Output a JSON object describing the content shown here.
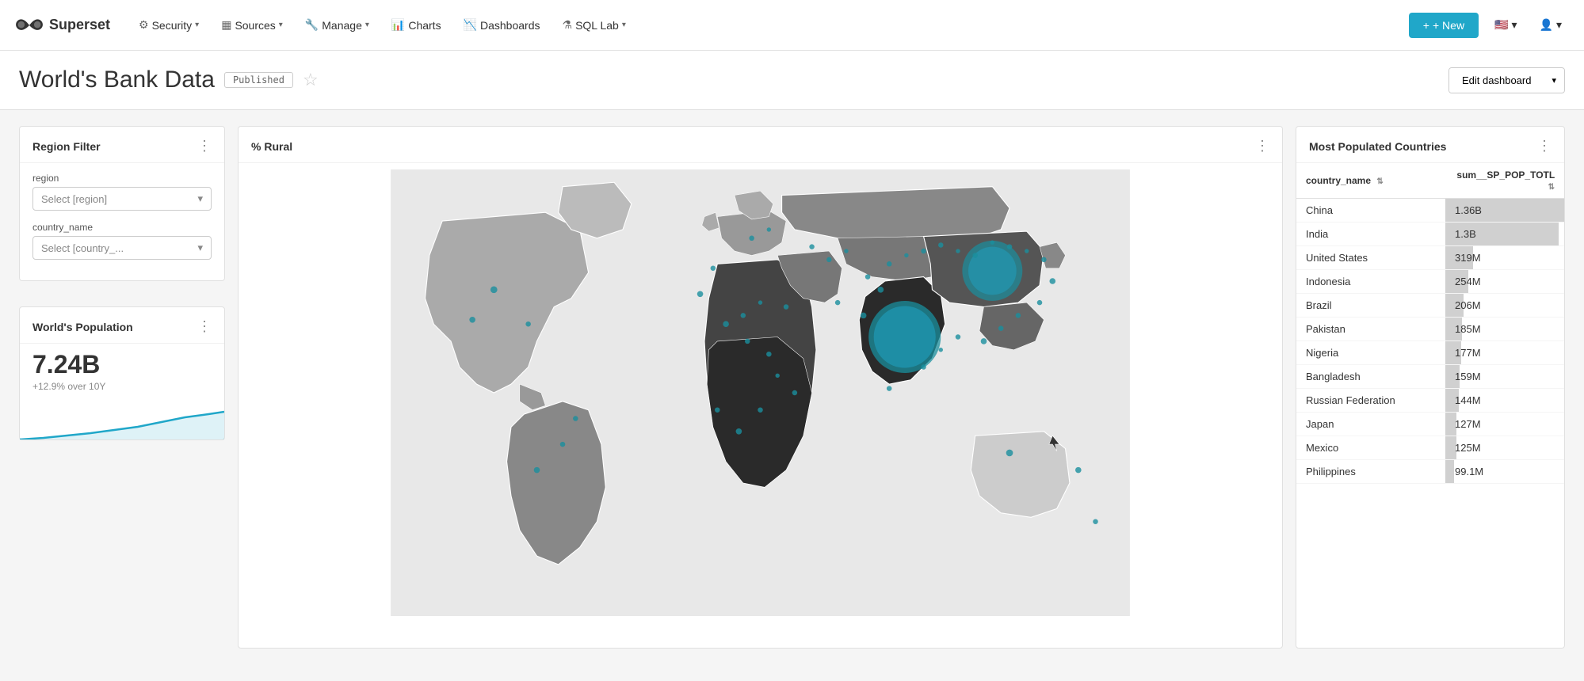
{
  "brand": {
    "name": "Superset"
  },
  "navbar": {
    "items": [
      {
        "id": "security",
        "label": "Security",
        "icon": "⚙",
        "hasDropdown": true
      },
      {
        "id": "sources",
        "label": "Sources",
        "icon": "▦",
        "hasDropdown": true
      },
      {
        "id": "manage",
        "label": "Manage",
        "icon": "🔧",
        "hasDropdown": true
      },
      {
        "id": "charts",
        "label": "Charts",
        "icon": "📊",
        "hasDropdown": false
      },
      {
        "id": "dashboards",
        "label": "Dashboards",
        "icon": "📉",
        "hasDropdown": false
      },
      {
        "id": "sqllab",
        "label": "SQL Lab",
        "icon": "⚗",
        "hasDropdown": true
      }
    ],
    "new_button": "+ New"
  },
  "dashboard": {
    "title": "World's Bank Data",
    "status_badge": "Published",
    "edit_button": "Edit dashboard",
    "star_label": "★"
  },
  "region_filter": {
    "title": "Region Filter",
    "region_label": "region",
    "region_placeholder": "Select [region]",
    "country_label": "country_name",
    "country_placeholder": "Select [country_..."
  },
  "population": {
    "title": "World's Population",
    "value": "7.24B",
    "change": "+12.9% over 10Y"
  },
  "map": {
    "title": "% Rural"
  },
  "table": {
    "title": "Most Populated Countries",
    "col1": "country_name",
    "col2": "sum__SP_POP_TOTL",
    "rows": [
      {
        "country": "China",
        "value": "1.36B",
        "pct": 100
      },
      {
        "country": "India",
        "value": "1.3B",
        "pct": 95
      },
      {
        "country": "United States",
        "value": "319M",
        "pct": 23
      },
      {
        "country": "Indonesia",
        "value": "254M",
        "pct": 19
      },
      {
        "country": "Brazil",
        "value": "206M",
        "pct": 15
      },
      {
        "country": "Pakistan",
        "value": "185M",
        "pct": 14
      },
      {
        "country": "Nigeria",
        "value": "177M",
        "pct": 13
      },
      {
        "country": "Bangladesh",
        "value": "159M",
        "pct": 12
      },
      {
        "country": "Russian Federation",
        "value": "144M",
        "pct": 11
      },
      {
        "country": "Japan",
        "value": "127M",
        "pct": 9
      },
      {
        "country": "Mexico",
        "value": "125M",
        "pct": 9
      },
      {
        "country": "Philippines",
        "value": "99.1M",
        "pct": 7
      }
    ]
  },
  "colors": {
    "accent": "#20a7c9",
    "bar": "#c8c8c8",
    "map_dark": "#2d2d2d",
    "map_medium": "#888",
    "map_light": "#ccc",
    "teal": "#1a7f9e"
  }
}
